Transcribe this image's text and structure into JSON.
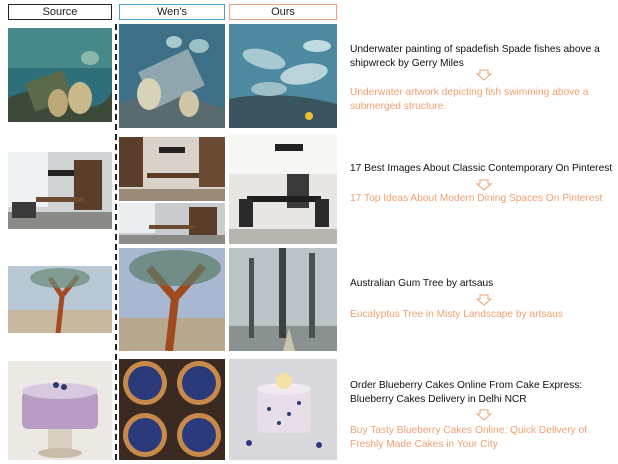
{
  "headers": {
    "source": "Source",
    "wen": "Wen's",
    "ours": "Ours"
  },
  "rows": [
    {
      "source_caption": "Underwater painting of spadefish Spade fishes above a shipwreck by Gerry Miles",
      "ours_caption": "Underwater artwork depicting fish swimming above a submerged structure."
    },
    {
      "source_caption": "17 Best Images About Classic Contemporary On Pinterest",
      "ours_caption": "17 Top Ideas About Modern Dining Spaces On Pinterest"
    },
    {
      "source_caption": "Australian Gum Tree by artsaus",
      "ours_caption": "Eucalyptus Tree in Misty Landscape by artsaus"
    },
    {
      "source_caption": "Order Blueberry Cakes Online From Cake Express: Blueberry Cakes Delivery in Delhi NCR",
      "ours_caption": "Buy Tasty Blueberry Cakes Online: Quick Delivery of Freshly Made Cakes in Your City"
    }
  ],
  "colors": {
    "source_border": "#222222",
    "wen_border": "#4aa3c8",
    "ours_border": "#e8a27a",
    "ours_text": "#f0a070",
    "arrow": "#f0a070"
  }
}
